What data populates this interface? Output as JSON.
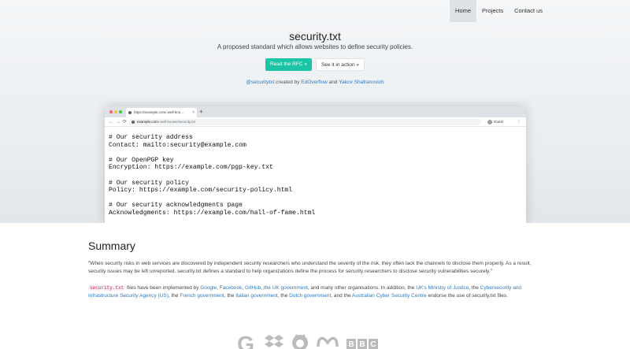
{
  "nav": {
    "items": [
      {
        "label": "Home",
        "active": true
      },
      {
        "label": "Projects",
        "active": false
      },
      {
        "label": "Contact us",
        "active": false
      }
    ]
  },
  "hero": {
    "title": "security.txt",
    "subtitle": "A proposed standard which allows websites to define security policies.",
    "primary_button": "Read the RFC »",
    "secondary_button": "See it in action »",
    "credits": {
      "handle": "@securitytxt",
      "created_by": "created by",
      "author1": "EdOverflow",
      "and": "and",
      "author2": "Yakov Shafranovich"
    }
  },
  "browser": {
    "tab_title": "https://example.com/.well-kno...",
    "tab_close": "×",
    "new_tab": "+",
    "url_host": "example.com",
    "url_path": "/.well-known/security.txt",
    "profile": "Guest",
    "content_lines": [
      "# Our security address",
      "Contact: mailto:security@example.com",
      "",
      "# Our OpenPGP key",
      "Encryption: https://example.com/pgp-key.txt",
      "",
      "# Our security policy",
      "Policy: https://example.com/security-policy.html",
      "",
      "# Our security acknowledgments page",
      "Acknowledgments: https://example.com/hall-of-fame.html"
    ]
  },
  "summary": {
    "heading": "Summary",
    "quote": "\"When security risks in web services are discovered by independent security researchers who understand the severity of the risk, they often lack the channels to disclose them properly. As a result, security issues may be left unreported. security.txt defines a standard to help organizations define the process for security researchers to disclose security vulnerabilities securely.\"",
    "p2": {
      "code": "security.txt",
      "t1": " files have been implemented by ",
      "google": "Google",
      "c1": ", ",
      "facebook": "Facebook",
      "c2": ", ",
      "github": "GitHub",
      "c3": ", ",
      "ukgov": "the UK government",
      "t2": ", and many other organisations. In addition, the ",
      "moj": "UK's Ministry of Justice",
      "c4": ", the ",
      "cisa": "Cybersecurity and Infrastructure Security Agency (US)",
      "c5": ", the ",
      "french": "French government",
      "c6": ", the ",
      "italian": "Italian government",
      "c7": ", the ",
      "dutch": "Dutch government",
      "t3": ", and the ",
      "acsc": "Australian Cyber Security Centre",
      "t4": " endorse the use of security.txt files."
    }
  },
  "logos": {
    "google_letter": "G",
    "bbc_letters": [
      "B",
      "B",
      "C"
    ]
  },
  "colors": {
    "accent": "#1cc4a6",
    "link": "#2b79c2",
    "code_text": "#c7254e"
  }
}
